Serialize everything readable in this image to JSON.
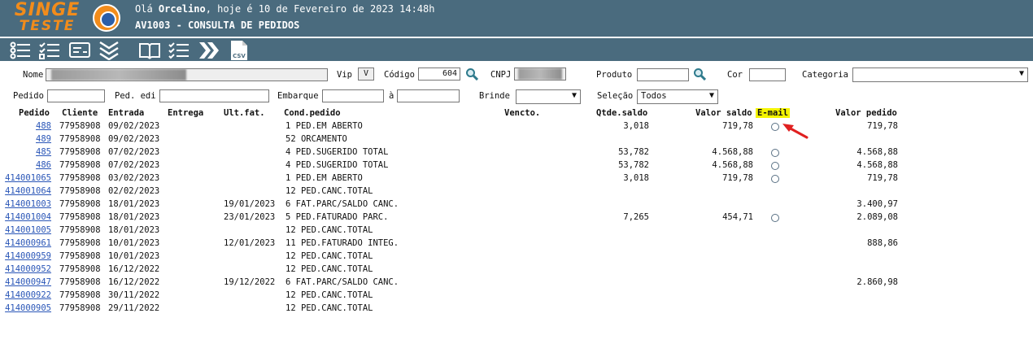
{
  "brand": {
    "line1": "SINGE",
    "line2": "TESTE"
  },
  "header": {
    "greeting_prefix": "Olá ",
    "user": "Orcelino",
    "greeting_suffix": ", hoje é 10 de Fevereiro de 2023 14:48h",
    "screen_title": "AV1003 - CONSULTA DE PEDIDOS"
  },
  "toolbar": [
    "list-icon",
    "checklist-icon",
    "card-icon",
    "chevrons-down-icon",
    "book-icon",
    "tasklist-icon",
    "double-chevron-right-icon",
    "csv-icon"
  ],
  "toolbar_csv_label": "CSV",
  "filters": {
    "nome_label": "Nome",
    "vip_label": "Vip",
    "vip_value": "V",
    "codigo_label": "Código",
    "codigo_value": "604",
    "cnpj_label": "CNPJ",
    "produto_label": "Produto",
    "cor_label": "Cor",
    "categoria_label": "Categoria",
    "pedido_label": "Pedido",
    "ped_edi_label": "Ped. edi",
    "embarque_label": "Embarque",
    "a_label": "à",
    "brinde_label": "Brinde",
    "selecao_label": "Seleção",
    "selecao_value": "Todos"
  },
  "columns": {
    "pedido": "Pedido",
    "cliente": "Cliente",
    "entrada": "Entrada",
    "entrega": "Entrega",
    "ult_fat": "Ult.fat.",
    "cond_pedido": "Cond.pedido",
    "vencto": "Vencto.",
    "qtde_saldo": "Qtde.saldo",
    "valor_saldo": "Valor saldo",
    "email": "E-mail",
    "valor_pedido": "Valor pedido"
  },
  "rows": [
    {
      "pedido": "488",
      "cliente": "77958908",
      "entrada": "09/02/2023",
      "ult_fat": "",
      "cond": "1 PED.EM ABERTO",
      "qtde": "3,018",
      "valor_saldo": "719,78",
      "email": true,
      "valor_pedido": "719,78"
    },
    {
      "pedido": "489",
      "cliente": "77958908",
      "entrada": "09/02/2023",
      "ult_fat": "",
      "cond": "52 ORCAMENTO",
      "qtde": "",
      "valor_saldo": "",
      "email": false,
      "valor_pedido": ""
    },
    {
      "pedido": "485",
      "cliente": "77958908",
      "entrada": "07/02/2023",
      "ult_fat": "",
      "cond": "4 PED.SUGERIDO TOTAL",
      "qtde": "53,782",
      "valor_saldo": "4.568,88",
      "email": true,
      "valor_pedido": "4.568,88"
    },
    {
      "pedido": "486",
      "cliente": "77958908",
      "entrada": "07/02/2023",
      "ult_fat": "",
      "cond": "4 PED.SUGERIDO TOTAL",
      "qtde": "53,782",
      "valor_saldo": "4.568,88",
      "email": true,
      "valor_pedido": "4.568,88"
    },
    {
      "pedido": "414001065",
      "cliente": "77958908",
      "entrada": "03/02/2023",
      "ult_fat": "",
      "cond": "1 PED.EM ABERTO",
      "qtde": "3,018",
      "valor_saldo": "719,78",
      "email": true,
      "valor_pedido": "719,78"
    },
    {
      "pedido": "414001064",
      "cliente": "77958908",
      "entrada": "02/02/2023",
      "ult_fat": "",
      "cond": "12 PED.CANC.TOTAL",
      "qtde": "",
      "valor_saldo": "",
      "email": false,
      "valor_pedido": ""
    },
    {
      "pedido": "414001003",
      "cliente": "77958908",
      "entrada": "18/01/2023",
      "ult_fat": "19/01/2023",
      "cond": "6 FAT.PARC/SALDO CANC.",
      "qtde": "",
      "valor_saldo": "",
      "email": false,
      "valor_pedido": "3.400,97"
    },
    {
      "pedido": "414001004",
      "cliente": "77958908",
      "entrada": "18/01/2023",
      "ult_fat": "23/01/2023",
      "cond": "5 PED.FATURADO PARC.",
      "qtde": "7,265",
      "valor_saldo": "454,71",
      "email": true,
      "valor_pedido": "2.089,08"
    },
    {
      "pedido": "414001005",
      "cliente": "77958908",
      "entrada": "18/01/2023",
      "ult_fat": "",
      "cond": "12 PED.CANC.TOTAL",
      "qtde": "",
      "valor_saldo": "",
      "email": false,
      "valor_pedido": ""
    },
    {
      "pedido": "414000961",
      "cliente": "77958908",
      "entrada": "10/01/2023",
      "ult_fat": "12/01/2023",
      "cond": "11 PED.FATURADO INTEG.",
      "qtde": "",
      "valor_saldo": "",
      "email": false,
      "valor_pedido": "888,86"
    },
    {
      "pedido": "414000959",
      "cliente": "77958908",
      "entrada": "10/01/2023",
      "ult_fat": "",
      "cond": "12 PED.CANC.TOTAL",
      "qtde": "",
      "valor_saldo": "",
      "email": false,
      "valor_pedido": ""
    },
    {
      "pedido": "414000952",
      "cliente": "77958908",
      "entrada": "16/12/2022",
      "ult_fat": "",
      "cond": "12 PED.CANC.TOTAL",
      "qtde": "",
      "valor_saldo": "",
      "email": false,
      "valor_pedido": ""
    },
    {
      "pedido": "414000947",
      "cliente": "77958908",
      "entrada": "16/12/2022",
      "ult_fat": "19/12/2022",
      "cond": "6 FAT.PARC/SALDO CANC.",
      "qtde": "",
      "valor_saldo": "",
      "email": false,
      "valor_pedido": "2.860,98"
    },
    {
      "pedido": "414000922",
      "cliente": "77958908",
      "entrada": "30/11/2022",
      "ult_fat": "",
      "cond": "12 PED.CANC.TOTAL",
      "qtde": "",
      "valor_saldo": "",
      "email": false,
      "valor_pedido": ""
    },
    {
      "pedido": "414000905",
      "cliente": "77958908",
      "entrada": "29/11/2022",
      "ult_fat": "",
      "cond": "12 PED.CANC.TOTAL",
      "qtde": "",
      "valor_saldo": "",
      "email": false,
      "valor_pedido": ""
    }
  ],
  "colors": {
    "header_bg": "#4a6b7e",
    "brand_orange": "#f28c1b",
    "link": "#2a56b7",
    "email_highlight": "#f4f400",
    "annotation_arrow": "#e02020"
  }
}
